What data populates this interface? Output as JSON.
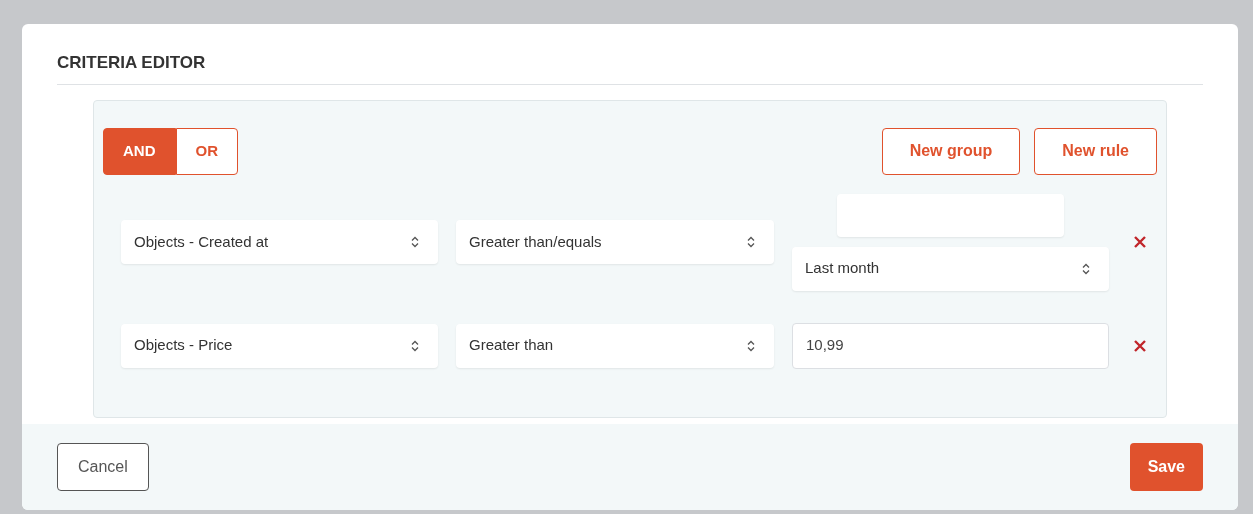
{
  "dialog": {
    "title": "CRITERIA EDITOR"
  },
  "group": {
    "conjunctions": [
      {
        "label": "AND",
        "selected": true
      },
      {
        "label": "OR",
        "selected": false
      }
    ],
    "actions": [
      "New group",
      "New rule"
    ],
    "rules": [
      {
        "field": "Objects - Created at",
        "operator": "Greater than/equals",
        "value": {
          "kind": "relative-date",
          "option": "Last month"
        }
      },
      {
        "field": "Objects - Price",
        "operator": "Greater than",
        "value": {
          "kind": "text",
          "text": "10,99"
        }
      }
    ]
  },
  "footer": {
    "cancel": "Cancel",
    "save": "Save"
  }
}
